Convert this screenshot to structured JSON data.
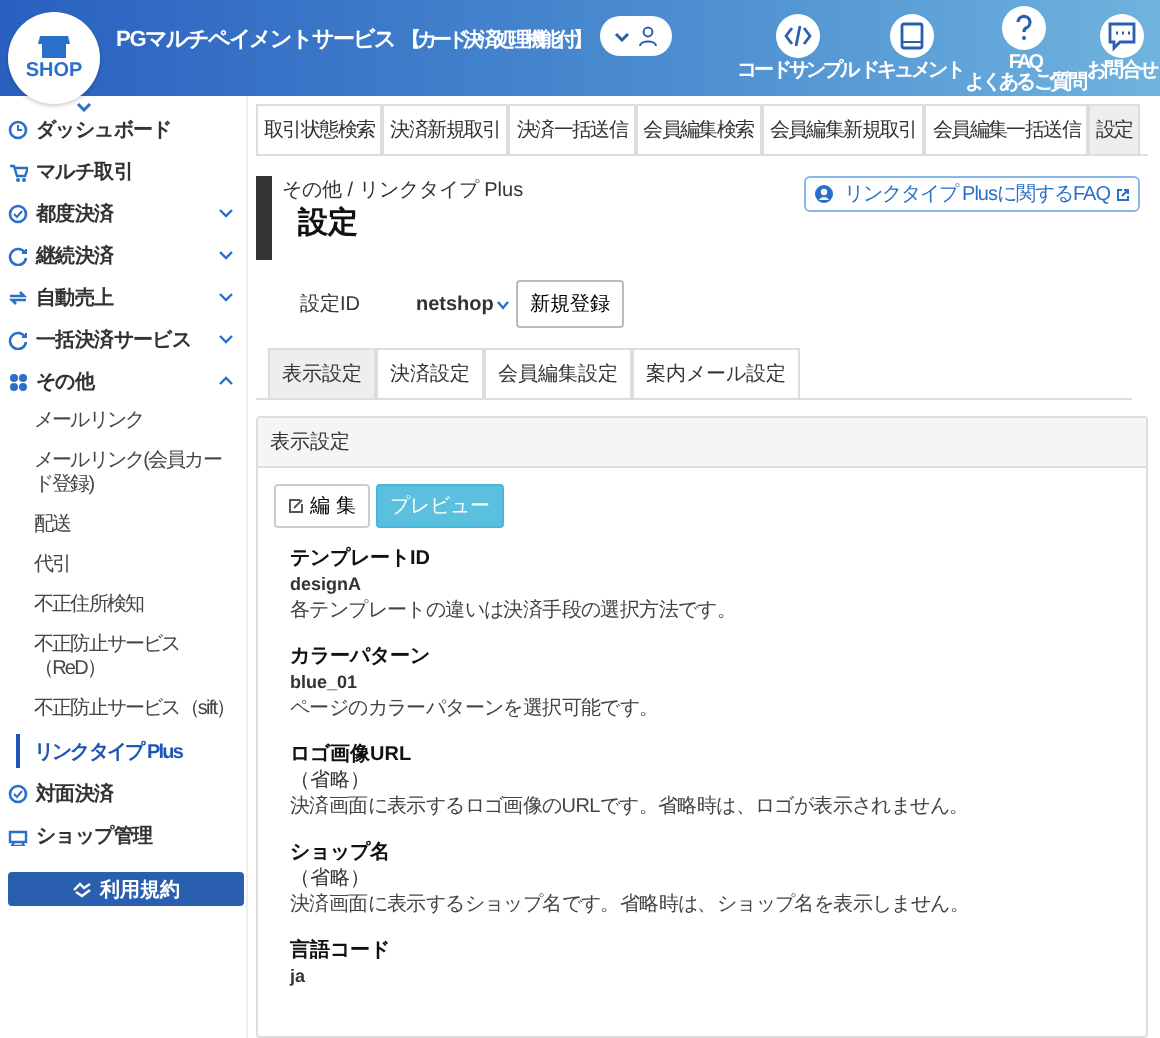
{
  "header": {
    "logo": "SHOP",
    "title": "PGマルチペイメントサービス",
    "badge": "【カード決済処理機能付】",
    "links": [
      {
        "kind": "code",
        "label": "コードサンプル"
      },
      {
        "kind": "book",
        "label": "ドキュメント"
      },
      {
        "kind": "help",
        "label": "FAQ",
        "sublabel": "よくあるご質問"
      },
      {
        "kind": "chat",
        "label": "お問合せ"
      }
    ]
  },
  "sidebar": {
    "items": [
      {
        "kind": "link",
        "label": "ダッシュボード"
      },
      {
        "kind": "link",
        "label": "マルチ取引"
      },
      {
        "kind": "group",
        "label": "都度決済",
        "expanded": false
      },
      {
        "kind": "group",
        "label": "継続決済",
        "expanded": false
      },
      {
        "kind": "group",
        "label": "自動売上",
        "expanded": false
      },
      {
        "kind": "group",
        "label": "一括決済サービス",
        "expanded": false
      },
      {
        "kind": "group",
        "label": "その他",
        "expanded": true,
        "children": [
          {
            "label": "メールリンク",
            "selected": false
          },
          {
            "label": "メールリンク(会員カード登録)",
            "selected": false
          },
          {
            "label": "配送",
            "selected": false
          },
          {
            "label": "代引",
            "selected": false
          },
          {
            "label": "不正住所検知",
            "selected": false
          },
          {
            "label": "不正防止サービス（ReD）",
            "selected": false
          },
          {
            "label": "不正防止サービス（sift）",
            "selected": false
          },
          {
            "label": "リンクタイプ Plus",
            "selected": true
          }
        ]
      },
      {
        "kind": "link",
        "label": "対面決済"
      },
      {
        "kind": "link",
        "label": "ショップ管理"
      }
    ],
    "button": "利用規約"
  },
  "top_tabs": [
    {
      "label": "取引状態検索",
      "selected": false
    },
    {
      "label": "決済新規取引",
      "selected": false
    },
    {
      "label": "決済一括送信",
      "selected": false
    },
    {
      "label": "会員編集検索",
      "selected": false
    },
    {
      "label": "会員編集新規取引",
      "selected": false
    },
    {
      "label": "会員編集一括送信",
      "selected": false
    },
    {
      "label": "設定",
      "selected": true
    }
  ],
  "page": {
    "breadcrumb": "その他 / リンクタイプ Plus",
    "title": "設定",
    "faq_link": "リンクタイプ Plusに関するFAQ"
  },
  "setting": {
    "label": "設定ID",
    "value": "netshop",
    "button": "新規登録"
  },
  "sub_tabs": [
    {
      "label": "表示設定",
      "selected": true
    },
    {
      "label": "決済設定",
      "selected": false
    },
    {
      "label": "会員編集設定",
      "selected": false
    },
    {
      "label": "案内メール設定",
      "selected": false
    }
  ],
  "panel": {
    "title": "表示設定",
    "edit_button": "編 集",
    "preview_button": "プレビュー",
    "fields": [
      {
        "kind": "set",
        "label": "テンプレートID",
        "value": "designA",
        "description": "各テンプレートの違いは決済手段の選択方法です。"
      },
      {
        "kind": "set",
        "label": "カラーパターン",
        "value": "blue_01",
        "description": "ページのカラーパターンを選択可能です。"
      },
      {
        "kind": "omitted",
        "label": "ロゴ画像URL",
        "value": "（省略）",
        "description": "決済画面に表示するロゴ画像のURLです。省略時は、ロゴが表示されません。"
      },
      {
        "kind": "omitted",
        "label": "ショップ名",
        "value": "（省略）",
        "description": "決済画面に表示するショップ名です。省略時は、ショップ名を表示しません。"
      },
      {
        "kind": "set",
        "label": "言語コード",
        "value": "ja"
      }
    ]
  }
}
